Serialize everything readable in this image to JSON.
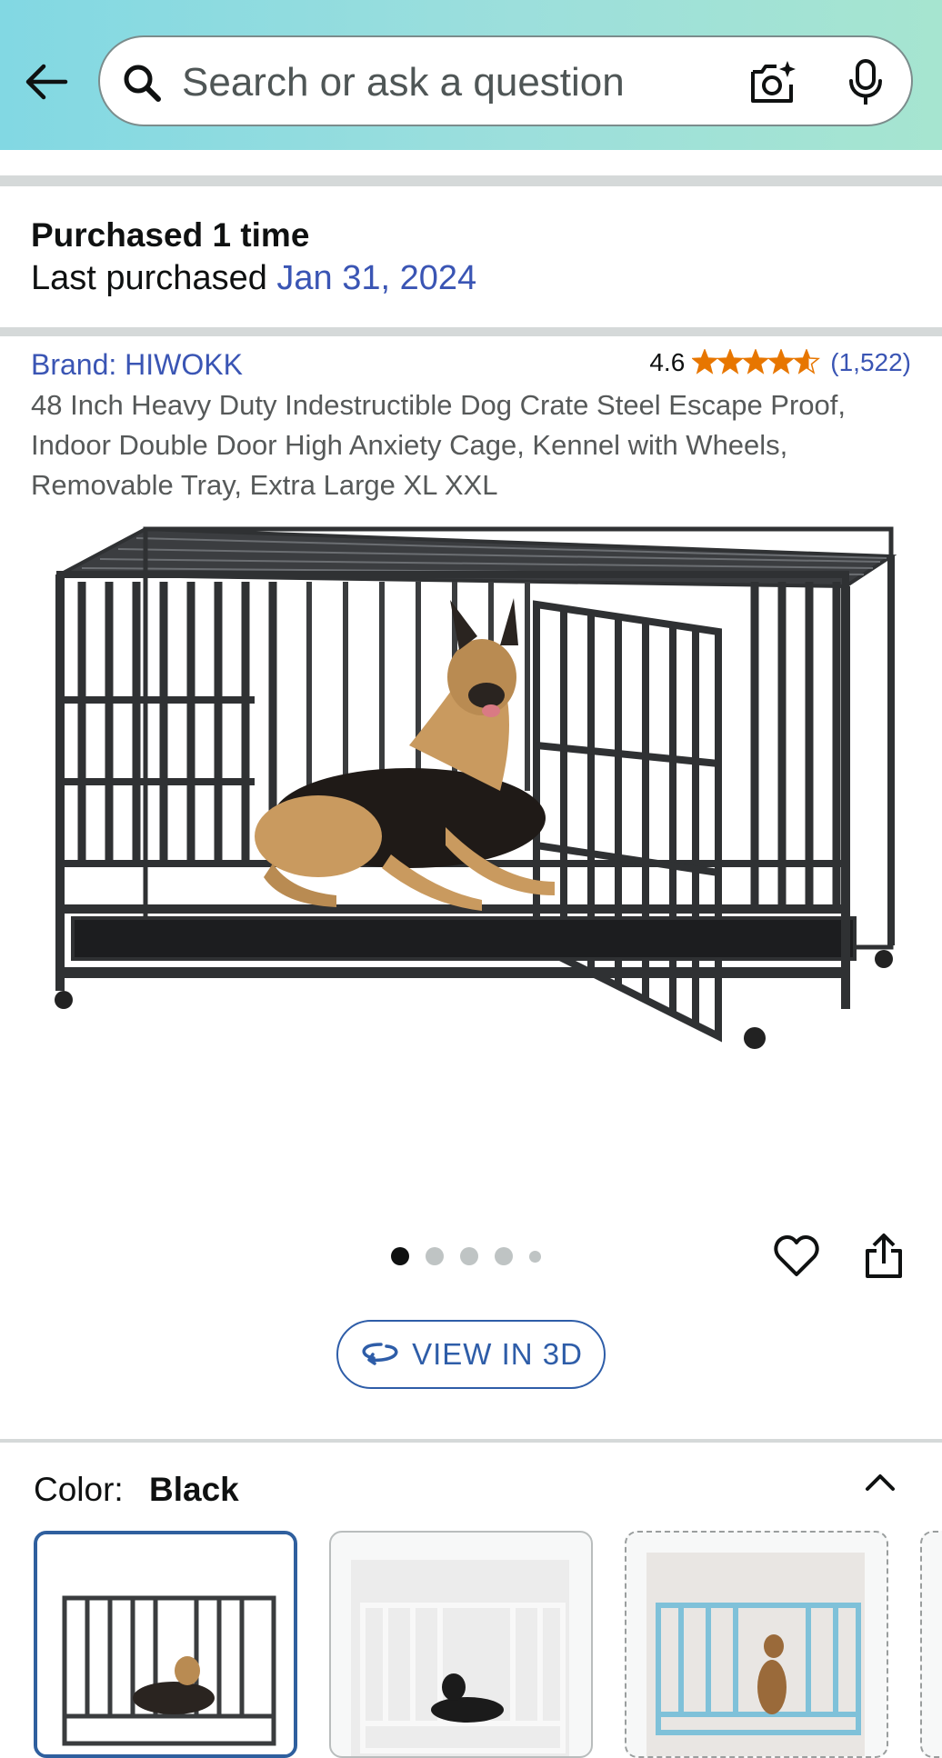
{
  "colors": {
    "accent_link": "#3a55b4",
    "star": "#e77600",
    "view3d": "#2e5da8",
    "selected_swatch_border": "#2f5f9e"
  },
  "header": {
    "back_icon": "back-arrow-icon",
    "search_placeholder": "Search or ask a question",
    "camera_icon": "camera-icon",
    "mic_icon": "microphone-icon"
  },
  "purchase": {
    "count_text": "Purchased 1 time",
    "last_label": "Last purchased ",
    "last_date": "Jan 31, 2024"
  },
  "product": {
    "brand": "Brand: HIWOKK",
    "rating_value": "4.6",
    "rating_stars": 4.6,
    "rating_count": "(1,522)",
    "title": "48 Inch Heavy Duty Indestructible Dog Crate Steel Escape Proof, Indoor Double Door High Anxiety Cage, Kennel with Wheels, Removable Tray, Extra Large XL XXL",
    "image_count": 5,
    "active_image": 1,
    "wishlist_icon": "heart-icon",
    "share_icon": "share-icon",
    "view3d_label": "VIEW IN 3D"
  },
  "color_selector": {
    "label": "Color:",
    "selected": "Black",
    "collapse_icon": "chevron-up-icon",
    "swatches": [
      "Black",
      "White",
      "Blue"
    ]
  }
}
